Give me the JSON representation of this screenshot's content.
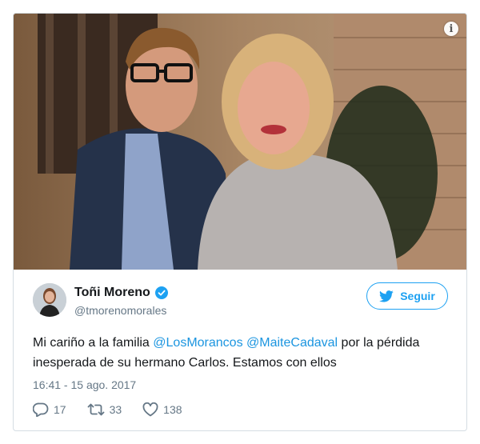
{
  "photo": {
    "alt": "",
    "info_icon": "info-icon"
  },
  "tweet": {
    "display_name": "Toñi Moreno",
    "verified_icon": "verified-badge-icon",
    "handle": "@tmorenomorales",
    "follow_label": "Seguir",
    "text_before": "Mi cariño a la familia ",
    "mention_1": "@LosMorancos",
    "space": " ",
    "mention_2": "@MaiteCadaval",
    "text_after": " por la pérdida inesperada de su hermano Carlos. Estamos con ellos",
    "timestamp": "16:41 - 15 ago. 2017",
    "replies": "17",
    "retweets": "33",
    "likes": "138"
  },
  "colors": {
    "accent": "#1da1f2",
    "mention": "#1b95e0",
    "muted": "#657786",
    "text": "#14171a"
  }
}
